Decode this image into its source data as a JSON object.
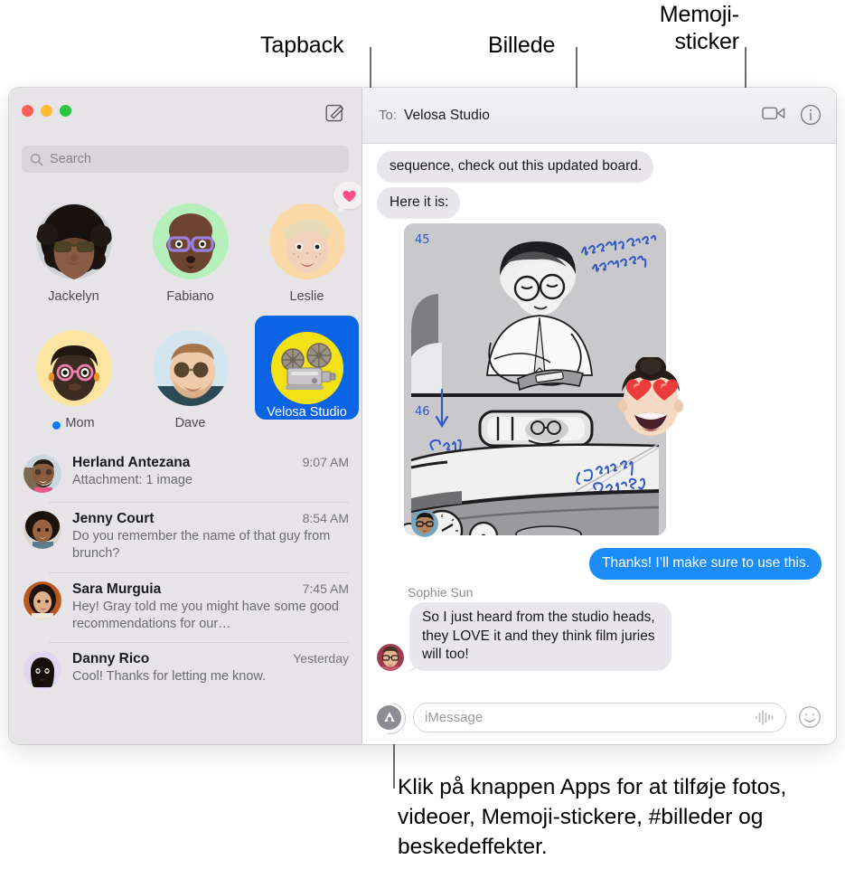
{
  "callouts": {
    "tapback": "Tapback",
    "billede": "Billede",
    "memoji": "Memoji-\nsticker",
    "bottom": "Klik på knappen Apps for at tilføje fotos, videoer, Memoji-stickere, #billeder og beskedeffekter."
  },
  "window": {
    "traffic_lights": [
      "close",
      "minimize",
      "zoom"
    ],
    "compose_icon": "compose-icon"
  },
  "sidebar": {
    "search": {
      "placeholder": "Search",
      "icon": "search-icon"
    },
    "pinned": [
      {
        "name": "Jackelyn",
        "tapback": false,
        "unread": false,
        "selected": false
      },
      {
        "name": "Fabiano",
        "tapback": false,
        "unread": false,
        "selected": false
      },
      {
        "name": "Leslie",
        "tapback": true,
        "unread": false,
        "selected": false,
        "tapback_icon": "heart-icon"
      },
      {
        "name": "Mom",
        "tapback": false,
        "unread": true,
        "selected": false
      },
      {
        "name": "Dave",
        "tapback": false,
        "unread": false,
        "selected": false
      },
      {
        "name": "Velosa Studio",
        "tapback": false,
        "unread": false,
        "selected": true
      }
    ],
    "conversations": [
      {
        "name": "Herland Antezana",
        "time": "9:07 AM",
        "preview": "Attachment: 1 image"
      },
      {
        "name": "Jenny Court",
        "time": "8:54 AM",
        "preview": "Do you remember the name of that guy from brunch?"
      },
      {
        "name": "Sara Murguia",
        "time": "7:45 AM",
        "preview": "Hey! Gray told me you might have some good recommendations for our…"
      },
      {
        "name": "Danny Rico",
        "time": "Yesterday",
        "preview": "Cool! Thanks for letting me know."
      }
    ]
  },
  "chat": {
    "header": {
      "to_label": "To:",
      "recipient": "Velosa Studio",
      "facetime_icon": "video-camera-icon",
      "details_icon": "info-circle-icon"
    },
    "messages": [
      {
        "dir": "in",
        "text": "sequence, check out this updated board."
      },
      {
        "dir": "in",
        "text": "Here it is:"
      },
      {
        "dir": "in",
        "type": "image",
        "caption_notes": [
          "45",
          "Hold on actor reading.",
          "46",
          "Cut (Fade in)",
          "Dialog Begins Here"
        ]
      },
      {
        "dir": "out",
        "text": "Thanks! I’ll make sure to use this."
      },
      {
        "dir": "in",
        "sender": "Sophie Sun",
        "text": "So I just heard from the studio heads, they LOVE it and they think film juries will too!"
      }
    ],
    "composer": {
      "apps_icon": "apps-store-icon",
      "placeholder": "iMessage",
      "audio_icon": "audio-waveform-icon",
      "emoji_icon": "smiley-face-icon"
    }
  },
  "colors": {
    "accent_blue": "#1c8cf8",
    "selected_tile": "#0b63e5",
    "incoming_bubble": "#e8e6eb",
    "sidebar_bg": "#e6e4e7",
    "tapback_pink": "#ff4f8b",
    "unread_blue": "#0b7bf5"
  }
}
